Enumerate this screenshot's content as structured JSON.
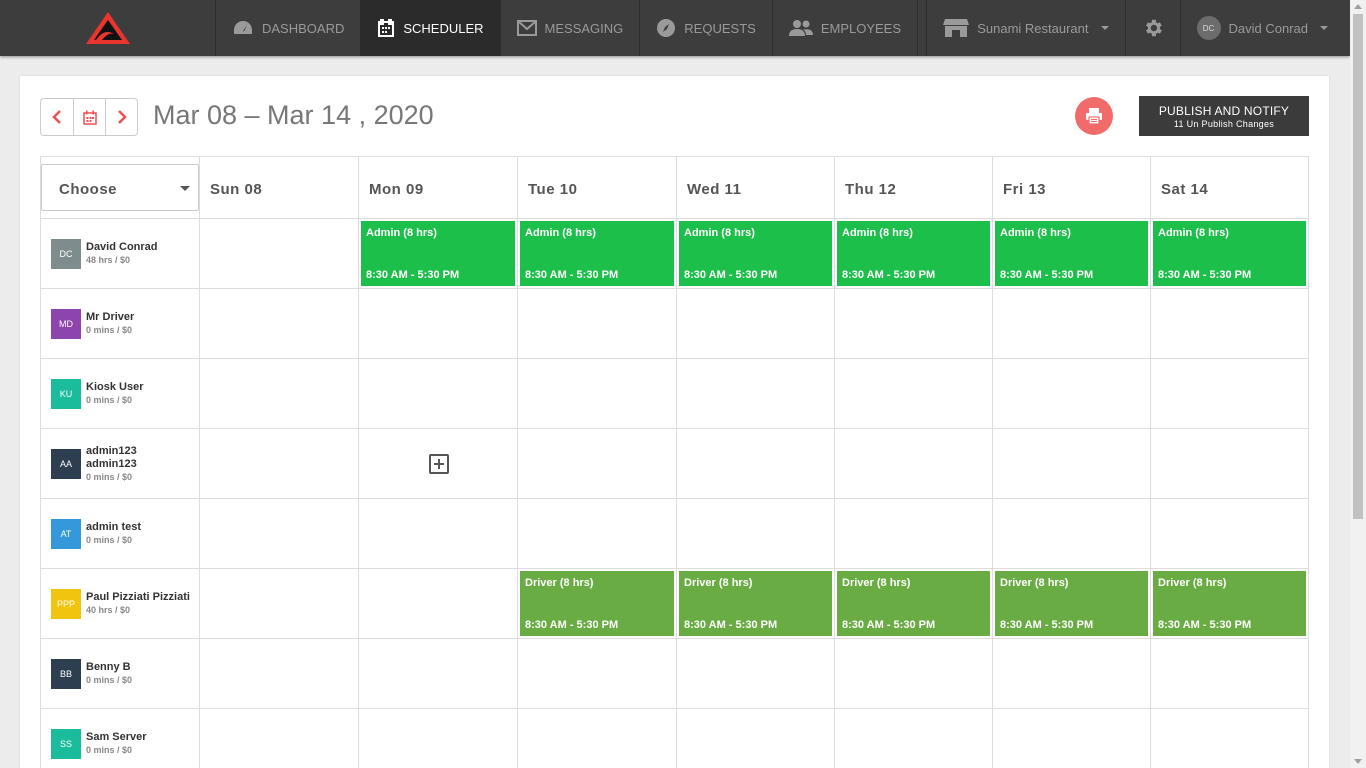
{
  "nav": {
    "items": [
      {
        "label": "DASHBOARD",
        "icon": "dashboard-icon"
      },
      {
        "label": "SCHEDULER",
        "icon": "calendar-icon"
      },
      {
        "label": "MESSAGING",
        "icon": "envelope-icon"
      },
      {
        "label": "REQUESTS",
        "icon": "compass-icon"
      },
      {
        "label": "EMPLOYEES",
        "icon": "users-icon"
      }
    ],
    "active": "SCHEDULER",
    "store": "Sunami Restaurant",
    "user_initials": "DC",
    "user_name": "David Conrad"
  },
  "scheduler": {
    "date_range": "Mar 08 – Mar 14 , 2020",
    "publish_label": "PUBLISH AND NOTIFY",
    "publish_sub": "11 Un Publish Changes",
    "choose_label": "Choose",
    "days": [
      "Sun 08",
      "Mon 09",
      "Tue 10",
      "Wed 11",
      "Thu 12",
      "Fri 13",
      "Sat 14"
    ],
    "employees": [
      {
        "initials": "DC",
        "name": "David Conrad",
        "hours": "48 hrs / $0",
        "color": "#7f8c8d"
      },
      {
        "initials": "MD",
        "name": "Mr Driver",
        "hours": "0 mins / $0",
        "color": "#8e44ad"
      },
      {
        "initials": "KU",
        "name": "Kiosk User",
        "hours": "0 mins / $0",
        "color": "#1abc9c"
      },
      {
        "initials": "AA",
        "name": "admin123",
        "name2": "admin123",
        "hours": "0 mins / $0",
        "color": "#2c3e50"
      },
      {
        "initials": "AT",
        "name": "admin test",
        "hours": "0 mins / $0",
        "color": "#3498db"
      },
      {
        "initials": "PPP",
        "name": "Paul Pizziati Pizziati",
        "hours": "40 hrs / $0",
        "color": "#f1c40f"
      },
      {
        "initials": "BB",
        "name": "Benny B",
        "hours": "0 mins / $0",
        "color": "#2c3e50"
      },
      {
        "initials": "SS",
        "name": "Sam Server",
        "hours": "0 mins / $0",
        "color": "#1abc9c"
      }
    ],
    "shift_admin": {
      "role": "Admin (8 hrs)",
      "time": "8:30 AM - 5:30 PM",
      "color": "#1dbf4b"
    },
    "shift_driver": {
      "role": "Driver (8 hrs)",
      "time": "8:30 AM - 5:30 PM",
      "color": "#6aac44"
    }
  }
}
